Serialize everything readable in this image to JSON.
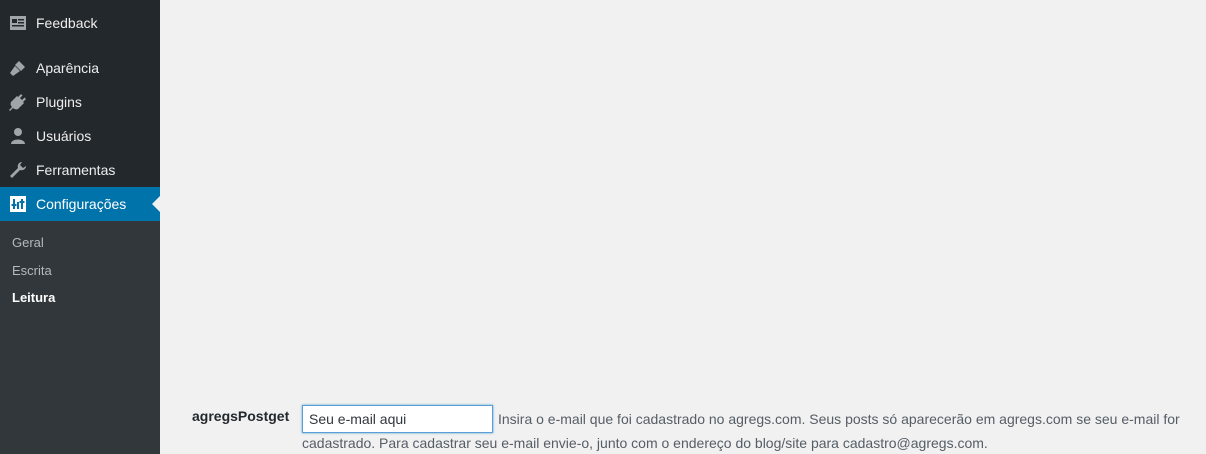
{
  "sidebar": {
    "items": [
      {
        "label": "Feedback",
        "icon": "feedback-icon"
      },
      {
        "label": "Aparência",
        "icon": "paintbrush-icon"
      },
      {
        "label": "Plugins",
        "icon": "plugin-icon"
      },
      {
        "label": "Usuários",
        "icon": "user-icon"
      },
      {
        "label": "Ferramentas",
        "icon": "wrench-icon"
      },
      {
        "label": "Configurações",
        "icon": "settings-icon",
        "active": true
      }
    ],
    "submenu": [
      {
        "label": "Geral"
      },
      {
        "label": "Escrita"
      },
      {
        "label": "Leitura",
        "current": true
      }
    ]
  },
  "form": {
    "label": "agregsPostget",
    "input_value": "Seu e-mail aqui",
    "description": "Insira o e-mail que foi cadastrado no agregs.com. Seus posts só aparecerão em agregs.com se seu e-mail for cadastrado. Para cadastrar seu e-mail envie-o, junto com o endereço do blog/site para cadastro@agregs.com."
  },
  "colors": {
    "sidebar_bg": "#23282d",
    "submenu_bg": "#32373c",
    "active_bg": "#0073aa",
    "page_bg": "#f1f1f1"
  }
}
